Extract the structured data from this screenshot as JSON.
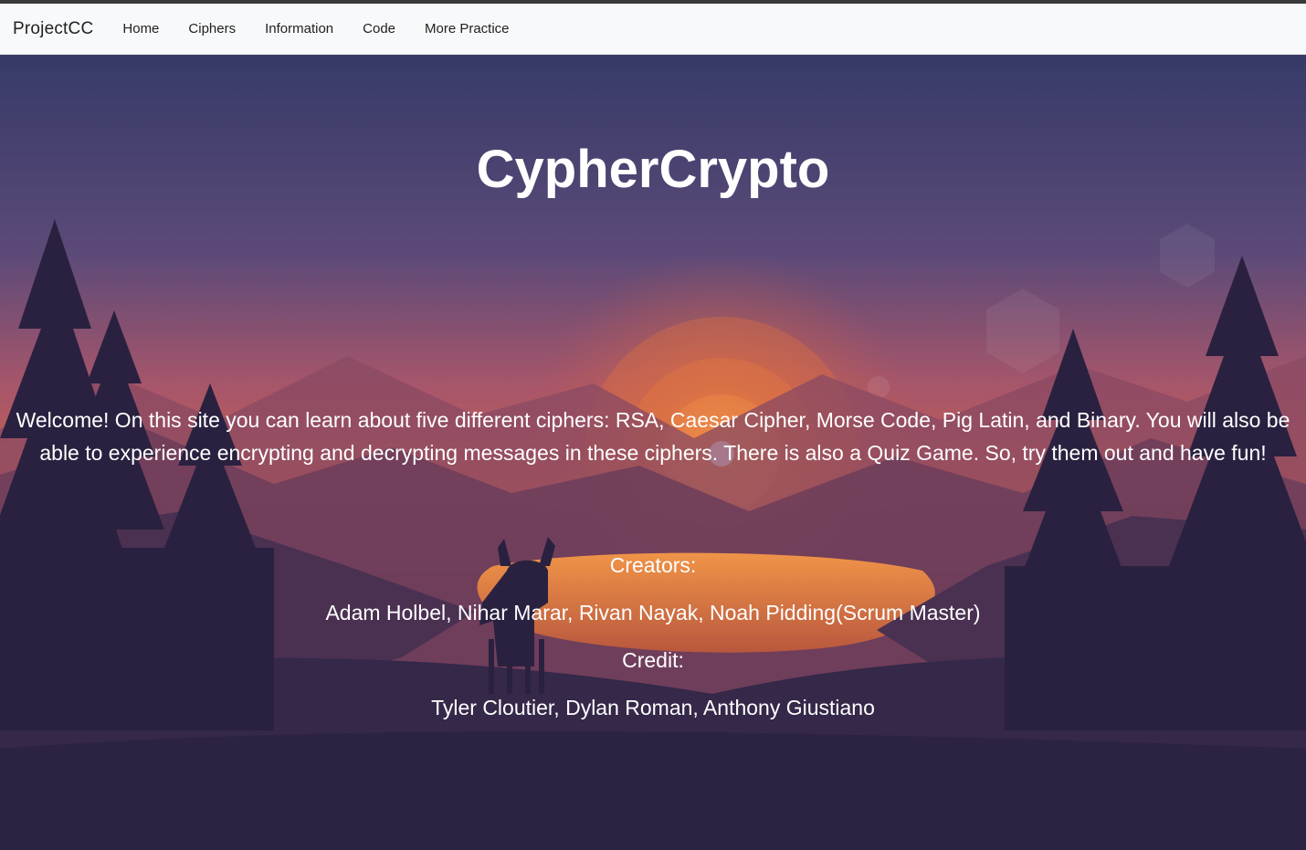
{
  "navbar": {
    "brand": "ProjectCC",
    "links": [
      "Home",
      "Ciphers",
      "Information",
      "Code",
      "More Practice"
    ]
  },
  "hero": {
    "title": "CypherCrypto",
    "welcome": "Welcome! On this site you can learn about five different ciphers: RSA, Caesar Cipher, Morse Code, Pig Latin, and Binary. You will also be able to experience encrypting and decrypting messages in these ciphers. There is also a Quiz Game. So, try them out and have fun!",
    "creators_label": "Creators:",
    "creators": "Adam Holbel, Nihar Marar, Rivan Nayak, Noah Pidding(Scrum Master)",
    "credit_label": "Credit:",
    "credit": "Tyler Cloutier, Dylan Roman, Anthony Giustiano"
  },
  "colors": {
    "sky_top": "#3d3f6e",
    "sky_mid": "#8a4e6e",
    "sun_glow": "#f0873a",
    "forest": "#2d2446",
    "navbar_bg": "#f8f9fa"
  }
}
